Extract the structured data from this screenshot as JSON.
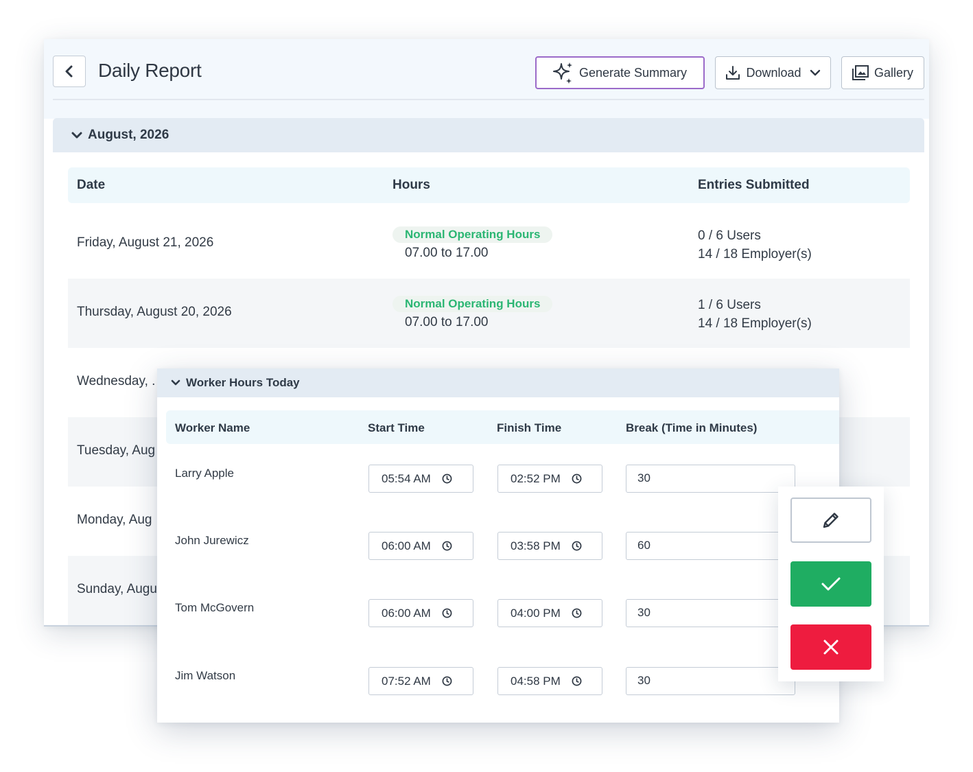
{
  "header": {
    "title": "Daily Report",
    "buttons": {
      "generate": "Generate Summary",
      "download": "Download",
      "gallery": "Gallery"
    }
  },
  "month": "August, 2026",
  "table": {
    "columns": [
      "Date",
      "Hours",
      "Entries Submitted"
    ],
    "rows": [
      {
        "date": "Friday, August 21, 2026",
        "hours_label": "Normal Operating Hours",
        "hours_range": "07.00 to 17.00",
        "users": "0 / 6 Users",
        "employers": "14 / 18 Employer(s)"
      },
      {
        "date": "Thursday, August 20, 2026",
        "hours_label": "Normal Operating Hours",
        "hours_range": "07.00 to 17.00",
        "users": "1 / 6 Users",
        "employers": "14 / 18 Employer(s)"
      },
      {
        "date": "Wednesday, ."
      },
      {
        "date": "Tuesday, Aug"
      },
      {
        "date": "Monday, Aug"
      },
      {
        "date": "Sunday, Augu"
      }
    ]
  },
  "worker_panel": {
    "title": "Worker Hours Today",
    "columns": [
      "Worker Name",
      "Start Time",
      "Finish Time",
      "Break (Time in Minutes)"
    ],
    "rows": [
      {
        "name": "Larry Apple",
        "start": "05:54  AM",
        "finish": "02:52  PM",
        "break": "30"
      },
      {
        "name": "John Jurewicz",
        "start": "06:00  AM",
        "finish": "03:58  PM",
        "break": "60"
      },
      {
        "name": "Tom McGovern",
        "start": "06:00  AM",
        "finish": "04:00  PM",
        "break": "30"
      },
      {
        "name": "Jim Watson",
        "start": "07:52  AM",
        "finish": "04:58  PM",
        "break": "30"
      }
    ]
  },
  "colors": {
    "accent_green": "#2bb673",
    "confirm_green": "#1fad62",
    "cancel_red": "#ee1c3f",
    "generate_border": "#9b6ac9"
  },
  "icons": [
    "back-chevron-icon",
    "sparkles-icon",
    "download-icon",
    "chevron-down-icon",
    "gallery-icon",
    "clock-icon",
    "pencil-icon",
    "check-icon",
    "close-icon"
  ]
}
